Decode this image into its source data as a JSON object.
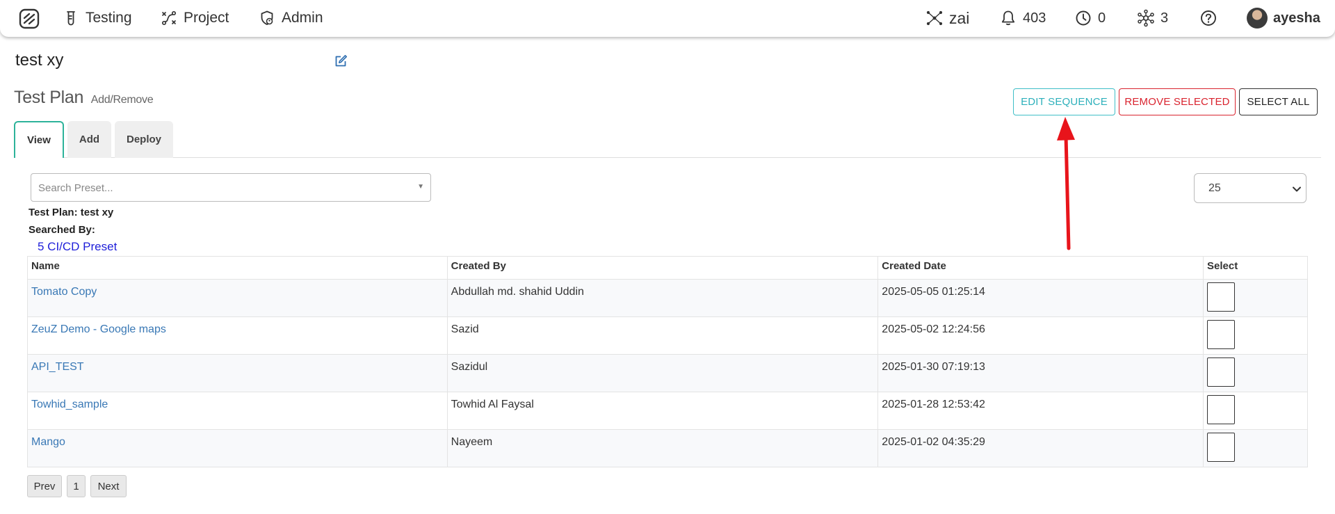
{
  "nav": {
    "items": [
      {
        "label": "Testing",
        "icon": "flask-icon"
      },
      {
        "label": "Project",
        "icon": "project-graph-icon"
      },
      {
        "label": "Admin",
        "icon": "admin-shield-icon"
      }
    ],
    "right": {
      "ai_label": "zai",
      "notifications": "403",
      "history_count": "0",
      "nodes_count": "3",
      "username": "ayesha"
    }
  },
  "page": {
    "project_title": "test xy",
    "section_title": "Test Plan",
    "section_sub": "Add/Remove"
  },
  "actions": {
    "edit_sequence": "EDIT SEQUENCE",
    "remove_selected": "REMOVE SELECTED",
    "select_all": "SELECT ALL"
  },
  "tabs": [
    {
      "label": "View",
      "active": true
    },
    {
      "label": "Add",
      "active": false
    },
    {
      "label": "Deploy",
      "active": false
    }
  ],
  "search": {
    "placeholder": "Search Preset..."
  },
  "page_size": "25",
  "info": {
    "test_plan": "Test Plan: test xy",
    "searched_by": "Searched By:",
    "preset_link": "5 CI/CD Preset"
  },
  "table": {
    "headers": [
      "Name",
      "Created By",
      "Created Date",
      "Select"
    ],
    "rows": [
      {
        "name": "Tomato Copy",
        "created_by": "Abdullah md. shahid Uddin",
        "created_date": "2025-05-05 01:25:14"
      },
      {
        "name": "ZeuZ Demo - Google maps",
        "created_by": "Sazid",
        "created_date": "2025-05-02 12:24:56"
      },
      {
        "name": "API_TEST",
        "created_by": "Sazidul",
        "created_date": "2025-01-30 07:19:13"
      },
      {
        "name": "Towhid_sample",
        "created_by": "Towhid Al Faysal",
        "created_date": "2025-01-28 12:53:42"
      },
      {
        "name": "Mango",
        "created_by": "Nayeem",
        "created_date": "2025-01-02 04:35:29"
      }
    ]
  },
  "pagination": {
    "prev": "Prev",
    "page": "1",
    "next": "Next"
  },
  "colors": {
    "accent_teal": "#2db0bb",
    "danger_red": "#d9232e",
    "link_blue": "#3978b5",
    "annotation_arrow": "#e8141b"
  }
}
